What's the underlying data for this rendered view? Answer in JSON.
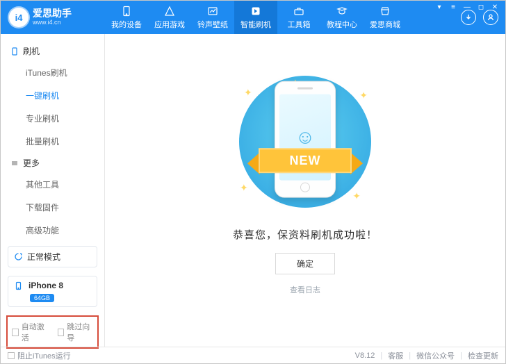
{
  "brand": {
    "title": "爱思助手",
    "subtitle": "www.i4.cn",
    "iconText": "i4"
  },
  "nav": {
    "items": [
      {
        "label": "我的设备"
      },
      {
        "label": "应用游戏"
      },
      {
        "label": "铃声壁纸"
      },
      {
        "label": "智能刷机"
      },
      {
        "label": "工具箱"
      },
      {
        "label": "教程中心"
      },
      {
        "label": "爱思商城"
      }
    ],
    "activeIndex": 3
  },
  "sidebar": {
    "group1": {
      "title": "刷机",
      "items": [
        "iTunes刷机",
        "一键刷机",
        "专业刷机",
        "批量刷机"
      ],
      "activeIndex": 1
    },
    "group2": {
      "title": "更多",
      "items": [
        "其他工具",
        "下载固件",
        "高级功能"
      ]
    }
  },
  "mode": {
    "label": "正常模式"
  },
  "device": {
    "name": "iPhone 8",
    "storage": "64GB"
  },
  "redbox": {
    "autoActivate": "自动激活",
    "skipWizard": "跳过向导"
  },
  "main": {
    "ribbon": "NEW",
    "successText": "恭喜您，保资料刷机成功啦！",
    "okButton": "确定",
    "viewLog": "查看日志"
  },
  "footer": {
    "blockItunes": "阻止iTunes运行",
    "version": "V8.12",
    "support": "客服",
    "wechat": "微信公众号",
    "checkUpdate": "检查更新"
  }
}
